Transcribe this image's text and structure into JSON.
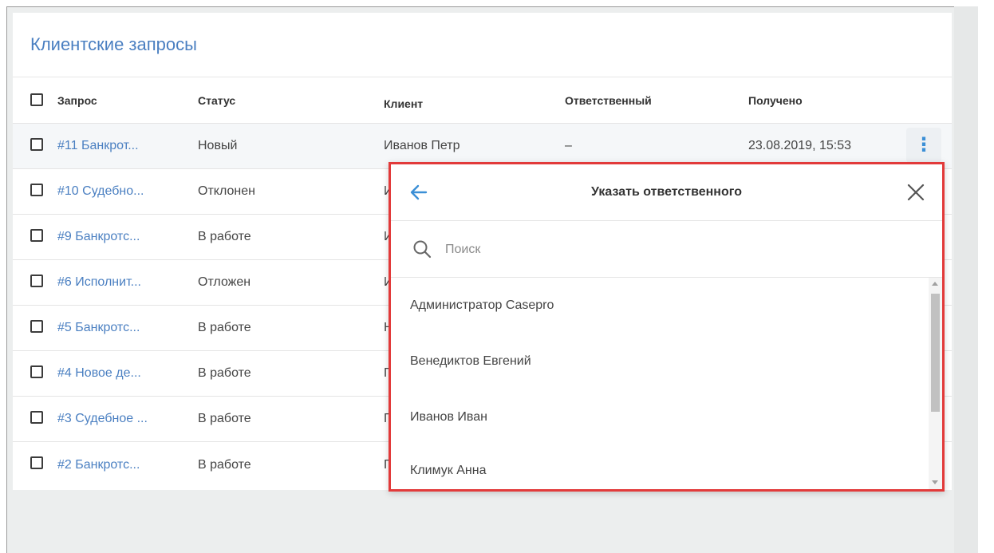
{
  "page": {
    "title": "Клиентские запросы"
  },
  "table": {
    "headers": {
      "request": "Запрос",
      "status": "Статус",
      "client": "Клиент",
      "responsible": "Ответственный",
      "received": "Получено"
    },
    "rows": [
      {
        "request": "#11 Банкрот...",
        "status": "Новый",
        "client": "Иванов Петр",
        "responsible": "–",
        "received": "23.08.2019, 15:53"
      },
      {
        "request": "#10 Судебно...",
        "status": "Отклонен",
        "client": "И",
        "responsible": "",
        "received": ""
      },
      {
        "request": "#9 Банкротс...",
        "status": "В работе",
        "client": "И",
        "responsible": "",
        "received": ""
      },
      {
        "request": "#6 Исполнит...",
        "status": "Отложен",
        "client": "И",
        "responsible": "",
        "received": ""
      },
      {
        "request": "#5 Банкротс...",
        "status": "В работе",
        "client": "Н",
        "responsible": "",
        "received": ""
      },
      {
        "request": "#4 Новое де...",
        "status": "В работе",
        "client": "П",
        "responsible": "",
        "received": ""
      },
      {
        "request": "#3 Судебное ...",
        "status": "В работе",
        "client": "П",
        "responsible": "",
        "received": ""
      },
      {
        "request": "#2 Банкротс...",
        "status": "В работе",
        "client": "П",
        "responsible": "",
        "received": ""
      }
    ],
    "row_menu_icon": "kebab-vertical-icon"
  },
  "assign_popup": {
    "title": "Указать ответственного",
    "back_icon": "arrow-left-icon",
    "close_icon": "close-icon",
    "search": {
      "placeholder": "Поиск",
      "value": "",
      "icon": "search-icon"
    },
    "users": [
      "Администратор Casepro",
      "Венедиктов Евгений",
      "Иванов Иван",
      "Климук Анна"
    ]
  },
  "colors": {
    "accent": "#4a7fc1",
    "kebab": "#3b8fd6",
    "highlight_border": "#e23a3a",
    "background": "#eceeee"
  }
}
